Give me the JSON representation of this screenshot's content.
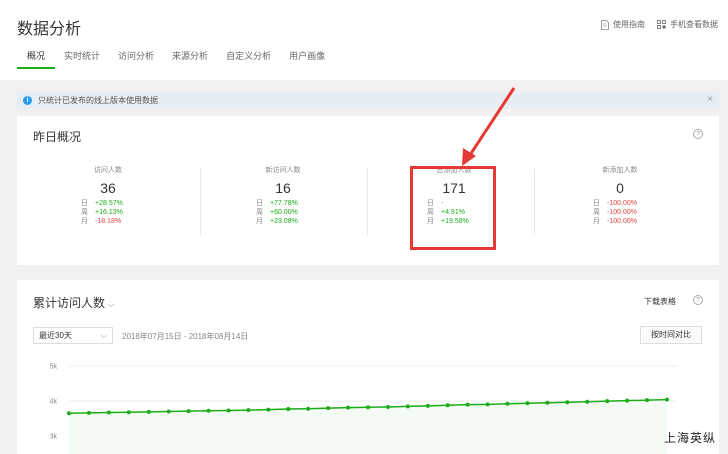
{
  "header": {
    "title": "数据分析",
    "links": [
      {
        "label": "使用指南",
        "icon": "document-icon"
      },
      {
        "label": "手机查看数据",
        "icon": "qr-code-icon"
      }
    ],
    "tabs": [
      "概况",
      "实时统计",
      "访问分析",
      "来源分析",
      "自定义分析",
      "用户画像"
    ],
    "active_tab": "概况"
  },
  "notice": {
    "text": "只统计已发布的线上版本使用数据",
    "close": "×"
  },
  "yesterday": {
    "title": "昨日概况",
    "help": "?",
    "stats": [
      {
        "label": "访问人数",
        "value": "36",
        "rows": [
          {
            "key": "日",
            "val": "+28.57%",
            "tone": "pos"
          },
          {
            "key": "周",
            "val": "+16.13%",
            "tone": "pos"
          },
          {
            "key": "月",
            "val": "-18.18%",
            "tone": "neg"
          }
        ]
      },
      {
        "label": "新访问人数",
        "value": "16",
        "rows": [
          {
            "key": "日",
            "val": "+77.78%",
            "tone": "pos"
          },
          {
            "key": "周",
            "val": "+60.00%",
            "tone": "pos"
          },
          {
            "key": "月",
            "val": "+23.08%",
            "tone": "pos"
          }
        ]
      },
      {
        "label": "总添加人数",
        "value": "171",
        "rows": [
          {
            "key": "日",
            "val": "-",
            "tone": "neu"
          },
          {
            "key": "周",
            "val": "+4.91%",
            "tone": "pos"
          },
          {
            "key": "月",
            "val": "+19.58%",
            "tone": "pos"
          }
        ]
      },
      {
        "label": "新添加人数",
        "value": "0",
        "rows": [
          {
            "key": "日",
            "val": "-100.00%",
            "tone": "neg"
          },
          {
            "key": "周",
            "val": "-100.00%",
            "tone": "neg"
          },
          {
            "key": "月",
            "val": "-100.00%",
            "tone": "neg"
          }
        ]
      }
    ]
  },
  "trend": {
    "title": "累计访问人数",
    "chevron": "⌵",
    "download": "下载表格",
    "help": "?",
    "range": "最近30天",
    "range_chevron": "⌵",
    "dates": "2018年07月15日 - 2018年08月14日",
    "compare": "按时间对比"
  },
  "chart_data": {
    "type": "line",
    "y_ticks": [
      "5k",
      "4k",
      "3k"
    ],
    "ylim": [
      3000,
      5000
    ],
    "series": [
      {
        "values": [
          3650,
          3660,
          3670,
          3680,
          3690,
          3700,
          3710,
          3720,
          3730,
          3740,
          3755,
          3770,
          3780,
          3795,
          3810,
          3820,
          3830,
          3845,
          3860,
          3880,
          3895,
          3905,
          3920,
          3935,
          3950,
          3965,
          3980,
          3995,
          4010,
          4025,
          4040
        ]
      }
    ],
    "color": "#1aad19",
    "grid": true
  },
  "watermark": "上海英纵",
  "colors": {
    "accent": "#1aad19",
    "negative": "#e64340",
    "highlight": "#e53935"
  }
}
